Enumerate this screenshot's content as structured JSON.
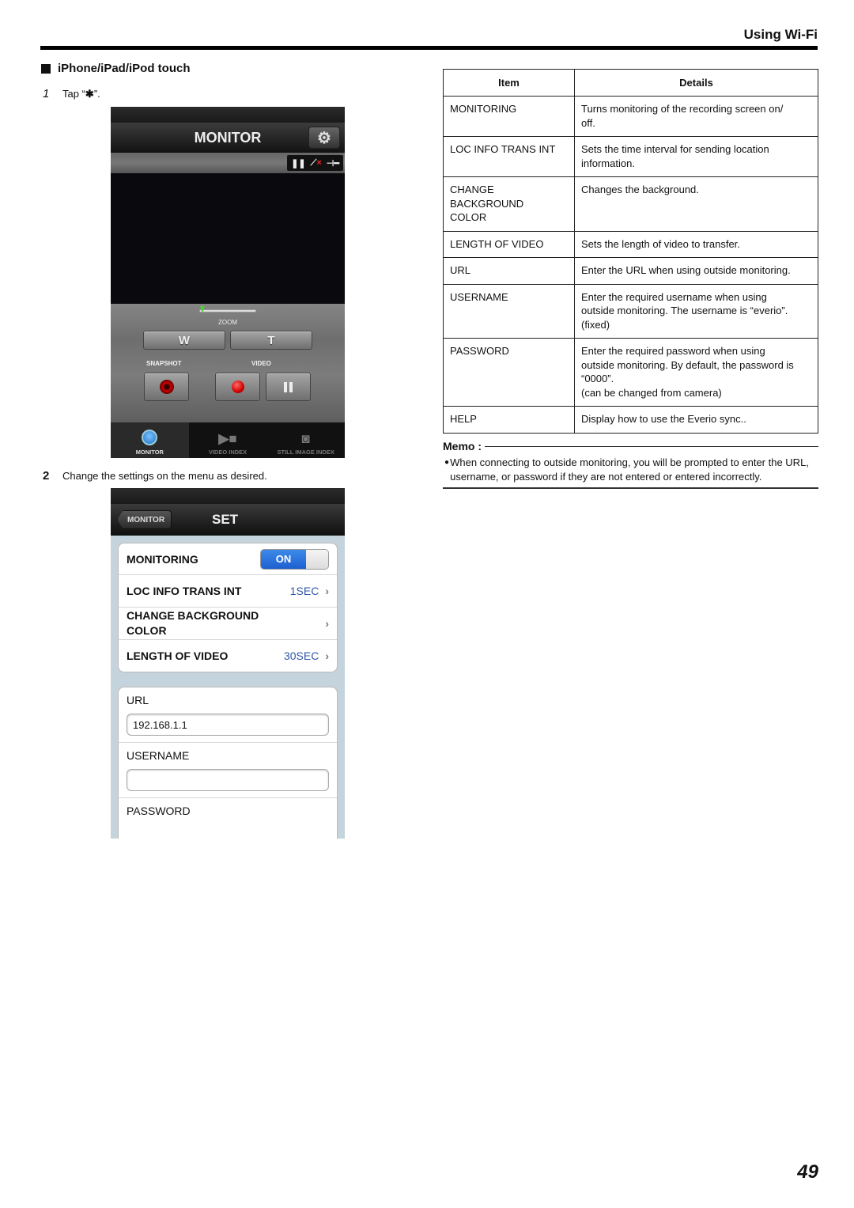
{
  "header": {
    "title": "Using Wi-Fi"
  },
  "section": {
    "title": "iPhone/iPad/iPod touch"
  },
  "steps": [
    {
      "number": "1",
      "text_before": "Tap “",
      "icon": "gear-icon",
      "text_after": "”."
    },
    {
      "number": "2",
      "text": "Change the settings on the menu as desired."
    }
  ],
  "monitor_screen": {
    "title": "MONITOR",
    "gear_button": "⚙",
    "status_icons": [
      "pause-icon",
      "gps-off-icon",
      "plug-icon"
    ],
    "zoom": {
      "label": "ZOOM",
      "level_fraction": 0.0,
      "wide_label": "W",
      "tele_label": "T"
    },
    "snapshot_label": "SNAPSHOT",
    "video_label": "VIDEO",
    "tabs": [
      {
        "label": "MONITOR",
        "icon": "person-icon",
        "active": true
      },
      {
        "label": "VIDEO INDEX",
        "icon": "camcorder-icon",
        "active": false
      },
      {
        "label": "STILL IMAGE INDEX",
        "icon": "camera-icon",
        "active": false
      }
    ]
  },
  "set_screen": {
    "back_label": "MONITOR",
    "title": "SET",
    "rows": [
      {
        "label": "MONITORING",
        "toggle_label": "ON"
      },
      {
        "label": "LOC INFO TRANS INT",
        "value": "1SEC"
      },
      {
        "label": "CHANGE BACKGROUND\nCOLOR",
        "value": ""
      },
      {
        "label": "LENGTH OF VIDEO",
        "value": "30SEC"
      }
    ],
    "fields": [
      {
        "label": "URL",
        "value": "192.168.1.1"
      },
      {
        "label": "USERNAME",
        "value": ""
      },
      {
        "label": "PASSWORD",
        "value": ""
      }
    ]
  },
  "table": {
    "headers": [
      "Item",
      "Details"
    ],
    "rows": [
      {
        "item": "MONITORING",
        "details": "Turns monitoring of the recording screen on/\noff."
      },
      {
        "item": "LOC INFO TRANS INT",
        "details": "Sets the time interval for sending location\ninformation."
      },
      {
        "item": "CHANGE\nBACKGROUND\nCOLOR",
        "details": "Changes the background."
      },
      {
        "item": "LENGTH OF VIDEO",
        "details": "Sets the length of video to transfer."
      },
      {
        "item": "URL",
        "details": "Enter the URL when using outside monitoring."
      },
      {
        "item": "USERNAME",
        "details": "Enter the required username when using\noutside monitoring. The username is “everio”.\n(fixed)"
      },
      {
        "item": "PASSWORD",
        "details": "Enter the required password when using\noutside monitoring. By default, the password is\n“0000”.\n(can be changed from camera)"
      },
      {
        "item": "HELP",
        "details": "Display how to use the Everio sync.."
      }
    ]
  },
  "memo": {
    "title": "Memo :",
    "items": [
      "When connecting to outside monitoring, you will be prompted to enter the URL, username, or password if they are not entered or entered incorrectly."
    ]
  },
  "page_number": "49"
}
